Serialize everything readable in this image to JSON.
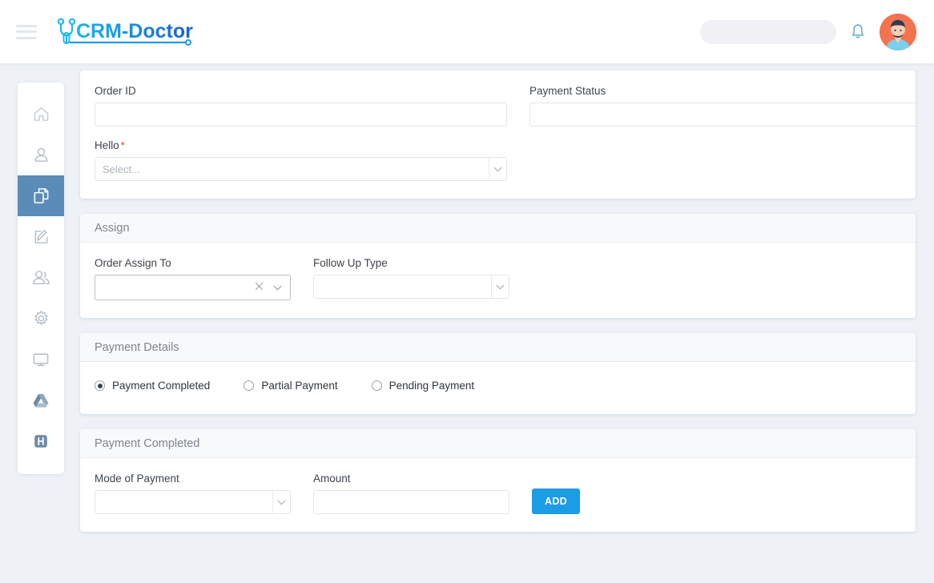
{
  "header": {
    "menu_icon": "hamburger-icon",
    "logo_text": "CRM-Doctor",
    "search_placeholder": "",
    "search_value": "",
    "search_icon": "search-icon",
    "bell_icon": "bell-icon",
    "avatar_icon": "user-avatar"
  },
  "sidebar": {
    "items": [
      {
        "name": "home",
        "icon": "home-icon",
        "active": false
      },
      {
        "name": "profile",
        "icon": "user-icon",
        "active": false
      },
      {
        "name": "orders",
        "icon": "documents-icon",
        "active": true
      },
      {
        "name": "edit",
        "icon": "edit-square-icon",
        "active": false
      },
      {
        "name": "customers",
        "icon": "users-icon",
        "active": false
      },
      {
        "name": "settings",
        "icon": "gear-icon",
        "active": false
      },
      {
        "name": "display",
        "icon": "monitor-icon",
        "active": false
      },
      {
        "name": "drive",
        "icon": "google-drive-icon",
        "active": false
      },
      {
        "name": "hospital",
        "icon": "h-badge-icon",
        "active": false
      }
    ]
  },
  "form": {
    "order_section": {
      "order_id": {
        "label": "Order ID",
        "value": "",
        "placeholder": ""
      },
      "payment_status": {
        "label": "Payment Status",
        "value": "",
        "placeholder": ""
      },
      "hello": {
        "label": "Hello",
        "required_marker": "*",
        "selected": "Select...",
        "options": [
          "Select..."
        ]
      }
    },
    "assign_section": {
      "title": "Assign",
      "order_assign_to": {
        "label": "Order Assign To",
        "selected": "",
        "clear_icon": "close-icon",
        "caret_icon": "chevron-down-icon"
      },
      "follow_up_type": {
        "label": "Follow Up Type",
        "selected": "",
        "caret_icon": "chevron-down-icon"
      }
    },
    "payment_details_section": {
      "title": "Payment Details",
      "options": [
        {
          "label": "Payment Completed",
          "checked": true
        },
        {
          "label": "Partial Payment",
          "checked": false
        },
        {
          "label": "Pending Payment",
          "checked": false
        }
      ]
    },
    "payment_completed_section": {
      "title": "Payment Completed",
      "mode_of_payment": {
        "label": "Mode of Payment",
        "selected": "",
        "caret_icon": "chevron-down-icon"
      },
      "amount": {
        "label": "Amount",
        "value": "",
        "placeholder": ""
      },
      "add_button": "ADD"
    }
  },
  "colors": {
    "page_background": "#eef2f7",
    "sidebar_active": "#5b8cb8",
    "add_button": "#1b9ce5",
    "required_marker": "#e8342a",
    "logo_gradient_from": "#1bb8f0",
    "logo_gradient_to": "#1a5fd0",
    "avatar_background": "#f4734f"
  }
}
